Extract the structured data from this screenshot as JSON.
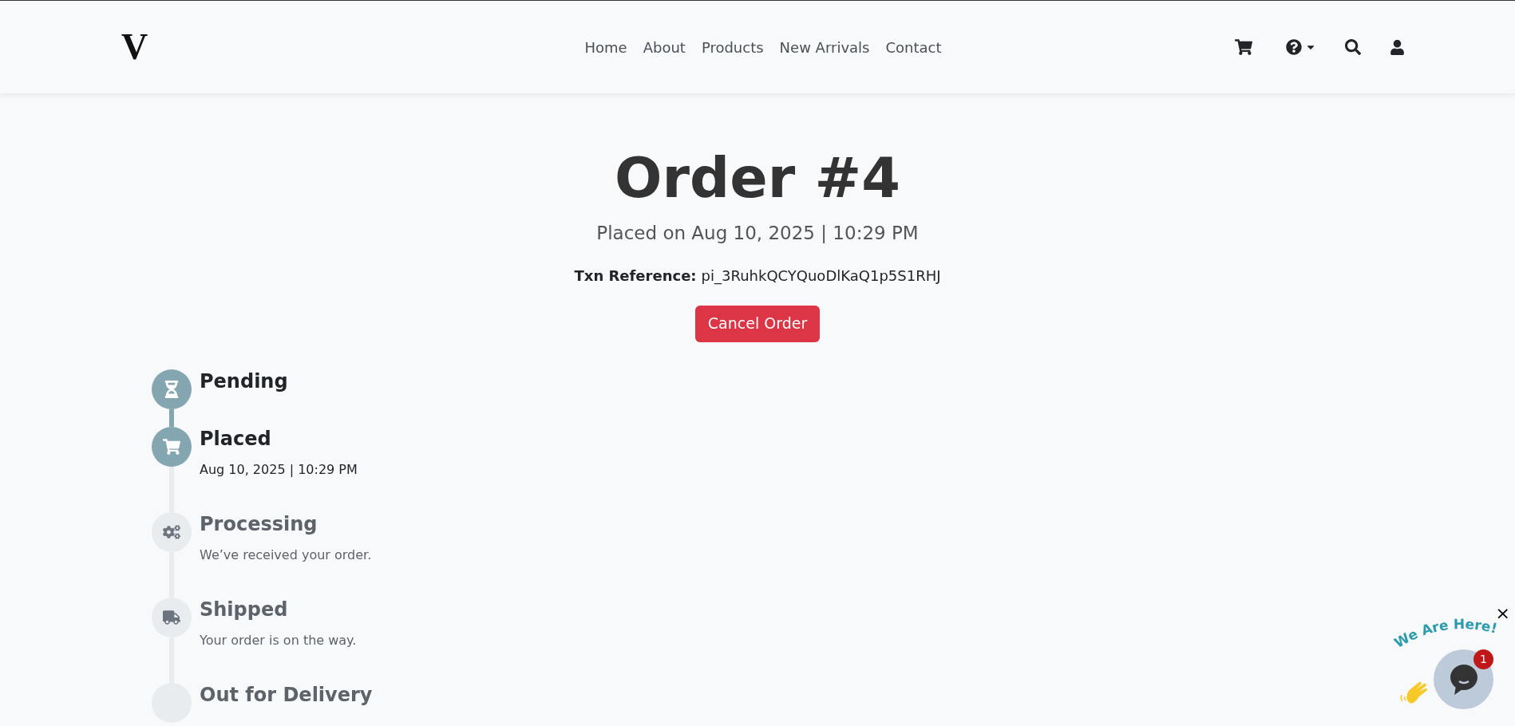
{
  "header": {
    "logo": "V",
    "nav": [
      "Home",
      "About",
      "Products",
      "New Arrivals",
      "Contact"
    ]
  },
  "order": {
    "title": "Order #4",
    "placed": "Placed on Aug 10, 2025 | 10:29 PM",
    "txn_label": "Txn Reference:",
    "txn_value": "pi_3RuhkQCYQuoDlKaQ1p5S1RHJ",
    "cancel": "Cancel Order"
  },
  "timeline": [
    {
      "kind": "pending",
      "title": "Pending",
      "done": true
    },
    {
      "kind": "placed",
      "title": "Placed",
      "detail": "Aug 10, 2025 | 10:29 PM",
      "done": true
    },
    {
      "kind": "processing",
      "title": "Processing",
      "detail": "We’ve received your order.",
      "done": false
    },
    {
      "kind": "shipped",
      "title": "Shipped",
      "detail": "Your order is on the way.",
      "done": false
    },
    {
      "kind": "delivery",
      "title": "Out for Delivery",
      "done": false
    }
  ],
  "chat": {
    "banner": "We Are Here!",
    "badge": "1",
    "close": "×"
  }
}
